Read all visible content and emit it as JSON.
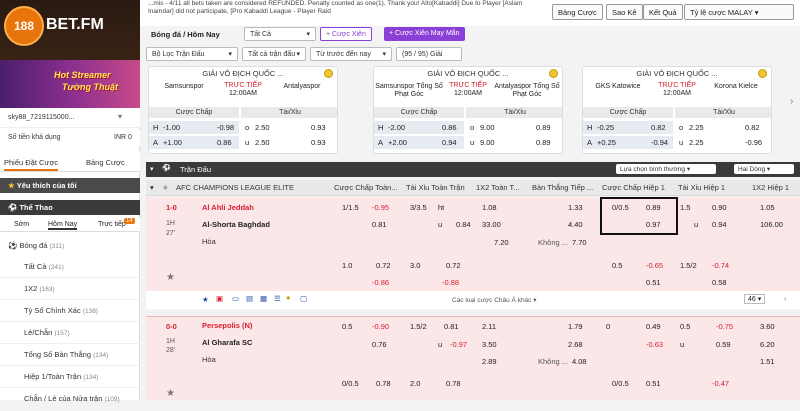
{
  "brand": {
    "logo_text": "188",
    "name": "BET.FM"
  },
  "promo": {
    "line1": "Hot Streamer",
    "line2": "Tường Thuật"
  },
  "account": {
    "username": "sky88_7219115000...",
    "balance_label": "Số tiền khả dụng",
    "balance_value": "INR 0"
  },
  "bet_slip": {
    "tab1": "Phiếu Đặt Cược",
    "tab2": "Bảng Cược"
  },
  "sidebar": {
    "favorites": "Yêu thích của tôi",
    "sports_header": "Thể Thao",
    "tabs": [
      "Sớm",
      "Hôm Nay",
      "Trực tiếp"
    ],
    "live_count": "14",
    "sport": "Bóng đá",
    "sport_count": "(311)",
    "items": [
      {
        "label": "Tất Cả",
        "count": "(241)"
      },
      {
        "label": "1X2",
        "count": "(163)"
      },
      {
        "label": "Tỷ Số Chính Xác",
        "count": "(138)"
      },
      {
        "label": "Lẻ/Chẵn",
        "count": "(157)"
      },
      {
        "label": "Tổng Số Bàn Thắng",
        "count": "(134)"
      },
      {
        "label": "Hiệp 1/Toàn Trận",
        "count": "(134)"
      },
      {
        "label": "Chẵn / Lẻ của Nửa trận",
        "count": "(109)"
      }
    ]
  },
  "topbar": {
    "ticker": "...mis - 4/11 all bets taken are considered REFUNDED. Penalty counted as one(1). Thank you! Alto[Kabaddi] Due to Player [Aslam Inamdar] did not participate, [Pro Kabaddi League - Player Raid",
    "buttons": [
      "Bảng Cược",
      "Sao Kê",
      "Kết Quả",
      "Tỷ lệ cược MALAY"
    ]
  },
  "filters": {
    "sport": "Bóng đá / Hôm Nay",
    "scope": "Tất Cả",
    "combo": "Cược Xiên",
    "lucky": "Cược Xiên May Mắn",
    "league_filter": "Bộ Lọc Trận Đấu",
    "match_filter": "Tất cả trận đấu",
    "sort": "Từ trước đến nay",
    "count": "(95 / 95) Giải"
  },
  "cards": [
    {
      "league": "GIẢI VÔ ĐỊCH QUỐC ...",
      "home": "Samsunspor",
      "away": "Antalyaspor",
      "status": "TRỰC TIẾP",
      "time": "12:00AM",
      "h_label": "H",
      "h_line": "-1.00",
      "h_odds": "-0.98",
      "h_ou": "o",
      "h_ou_line": "2.50",
      "h_ou_odds": "0.93",
      "a_label": "A",
      "a_line": "+1.00",
      "a_odds": "0.86",
      "a_ou": "u",
      "a_ou_line": "2.50",
      "a_ou_odds": "0.93"
    },
    {
      "league": "GIẢI VÔ ĐỊCH QUỐC ...",
      "home": "Samsunspor Tổng Số Phạt Góc",
      "away": "Antalyaspor Tổng Số Phạt Góc",
      "status": "TRỰC TIẾP",
      "time": "12:00AM",
      "h_label": "H",
      "h_line": "-2.00",
      "h_odds": "0.86",
      "h_ou": "o",
      "h_ou_line": "9.00",
      "h_ou_odds": "0.89",
      "a_label": "A",
      "a_line": "+2.00",
      "a_odds": "0.94",
      "a_ou": "u",
      "a_ou_line": "9.00",
      "a_ou_odds": "0.89"
    },
    {
      "league": "GIẢI VÔ ĐỊCH QUỐC ...",
      "home": "GKS Katowice",
      "away": "Korona Kielce",
      "status": "TRỰC TIẾP",
      "time": "12:00AM",
      "h_label": "H",
      "h_line": "-0.25",
      "h_odds": "0.82",
      "h_ou": "o",
      "h_ou_line": "2.25",
      "h_ou_odds": "0.82",
      "a_label": "A",
      "a_line": "+0.25",
      "a_odds": "-0.94",
      "a_ou": "u",
      "a_ou_line": "2.25",
      "a_ou_odds": "-0.96"
    }
  ],
  "card_headers": {
    "handicap": "Cược Chấp",
    "ou": "Tài/Xỉu"
  },
  "table": {
    "tab": "Trận Đấu",
    "view_select": "Lựa chọn bình thường",
    "line_select": "Hai Dòng",
    "league": "AFC CHAMPIONS LEAGUE ELITE",
    "columns": [
      "Cược Chấp Toàn...",
      "Tài Xỉu Toàn Trận",
      "1X2 Toàn T...",
      "Bàn Thắng Tiếp ...",
      "Cược Chấp Hiệp 1",
      "Tài Xỉu Hiệp 1",
      "1X2 Hiệp 1"
    ],
    "more_bets": "Các loại cược Châu Á khác",
    "more_count": "46",
    "matches": [
      {
        "score": "1-0",
        "period": "1H",
        "minute": "27'",
        "home": "Al Ahli Jeddah",
        "away": "Al-Shorta Baghdad",
        "draw": "Hòa",
        "r1": [
          "1/1.5",
          "-0.95",
          "3/3.5",
          "ht",
          "1.08",
          "",
          "1.33",
          "0/0.5",
          "0.89",
          "1.5",
          "0.90",
          "1.05"
        ],
        "r2": [
          "",
          "0.81",
          "",
          "u",
          "0.84",
          "33.00",
          "4.40",
          "",
          "0.97",
          "",
          "u",
          "0.94",
          "106.00"
        ],
        "r3": [
          "7.20",
          "Không ...",
          "7.70"
        ],
        "s1": [
          "1.0",
          "0.72",
          "3.0",
          "0.72",
          "",
          "",
          "",
          "0.5",
          "-0.65",
          "1.5/2",
          "-0.74"
        ],
        "s2": [
          "",
          "-0.86",
          "",
          "-0.88",
          "",
          "",
          "",
          "",
          "0.51",
          "",
          "0.58"
        ]
      },
      {
        "score": "0-0",
        "period": "1H",
        "minute": "28'",
        "home": "Persepolis (N)",
        "away": "Al Gharafa SC",
        "draw": "Hòa",
        "r1": [
          "0.5",
          "-0.90",
          "1.5/2",
          "0.81",
          "2.11",
          "1.79",
          "0",
          "0.49",
          "0.5",
          "-0.75",
          "3.60"
        ],
        "r2": [
          "",
          "0.76",
          "",
          "u",
          "-0.97",
          "3.50",
          "2.68",
          "",
          "-0.63",
          "u",
          "0.59",
          "6.20"
        ],
        "r3": [
          "2.89",
          "Không ...",
          "4.08",
          "1.51"
        ],
        "s1": [
          "0/0.5",
          "0.78",
          "2.0",
          "0.78",
          "0/0.5",
          "0.51",
          "-0.47"
        ]
      }
    ]
  }
}
